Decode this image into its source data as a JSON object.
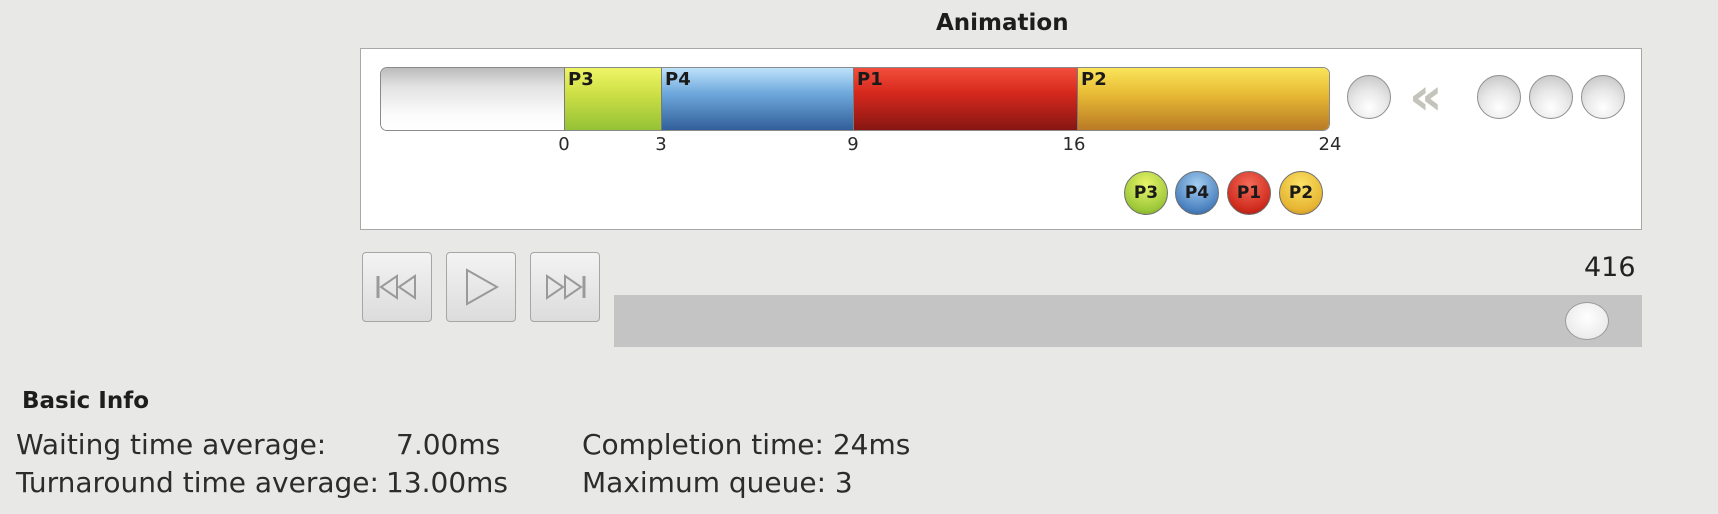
{
  "animation": {
    "title": "Animation",
    "gantt": {
      "processes": [
        "P3",
        "P4",
        "P1",
        "P2"
      ],
      "colors": {
        "P3": "#c8dc44",
        "P4": "#5a8fcb",
        "P1": "#cf2b1d",
        "P2": "#e8b834"
      },
      "ticks": [
        "0",
        "3",
        "9",
        "16",
        "24"
      ]
    },
    "queue_slots": 4,
    "rewind_icon": "rewind-icon",
    "legend": [
      "P3",
      "P4",
      "P1",
      "P2"
    ]
  },
  "controls": {
    "first_icon": "skip-to-start-icon",
    "play_icon": "play-icon",
    "last_icon": "skip-to-end-icon",
    "slider_value": "416",
    "slider_fraction": 0.97
  },
  "basic_info": {
    "title": "Basic Info",
    "waiting_label": "Waiting time average:",
    "waiting_value": "7.00ms",
    "turnaround_label": "Turnaround time average:",
    "turnaround_value": "13.00ms",
    "completion": "Completion time: 24ms",
    "max_queue": "Maximum queue: 3"
  }
}
